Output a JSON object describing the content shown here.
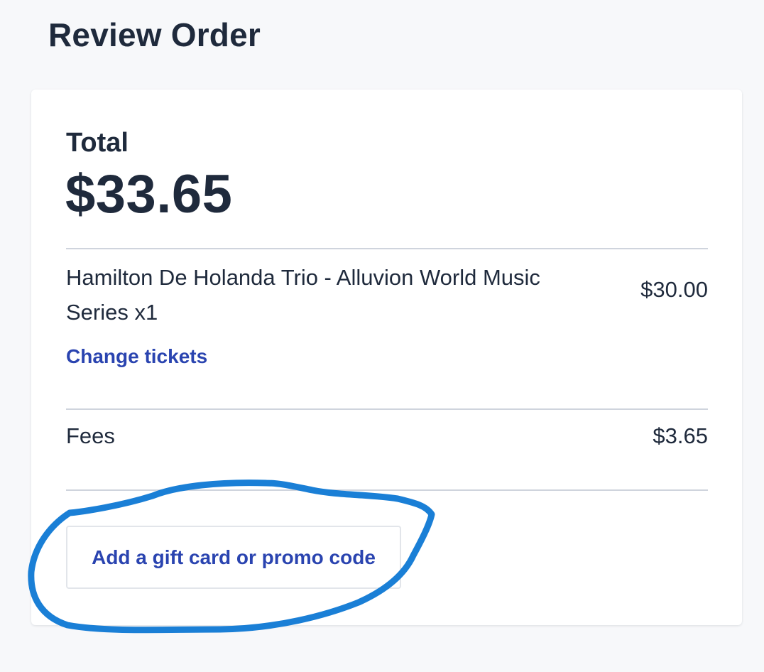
{
  "header": {
    "title": "Review Order"
  },
  "summary": {
    "total_label": "Total",
    "total_amount": "$33.65",
    "line_item": {
      "name": "Hamilton De Holanda Trio - Alluvion World Music Series x1",
      "price": "$30.00"
    },
    "change_link": "Change tickets",
    "fees": {
      "label": "Fees",
      "amount": "$3.65"
    },
    "promo_button": "Add a gift card or promo code"
  },
  "colors": {
    "text": "#1f2a3c",
    "link": "#2a44b0",
    "annotation_stroke": "#1a7fd6",
    "background": "#f7f8fa"
  }
}
